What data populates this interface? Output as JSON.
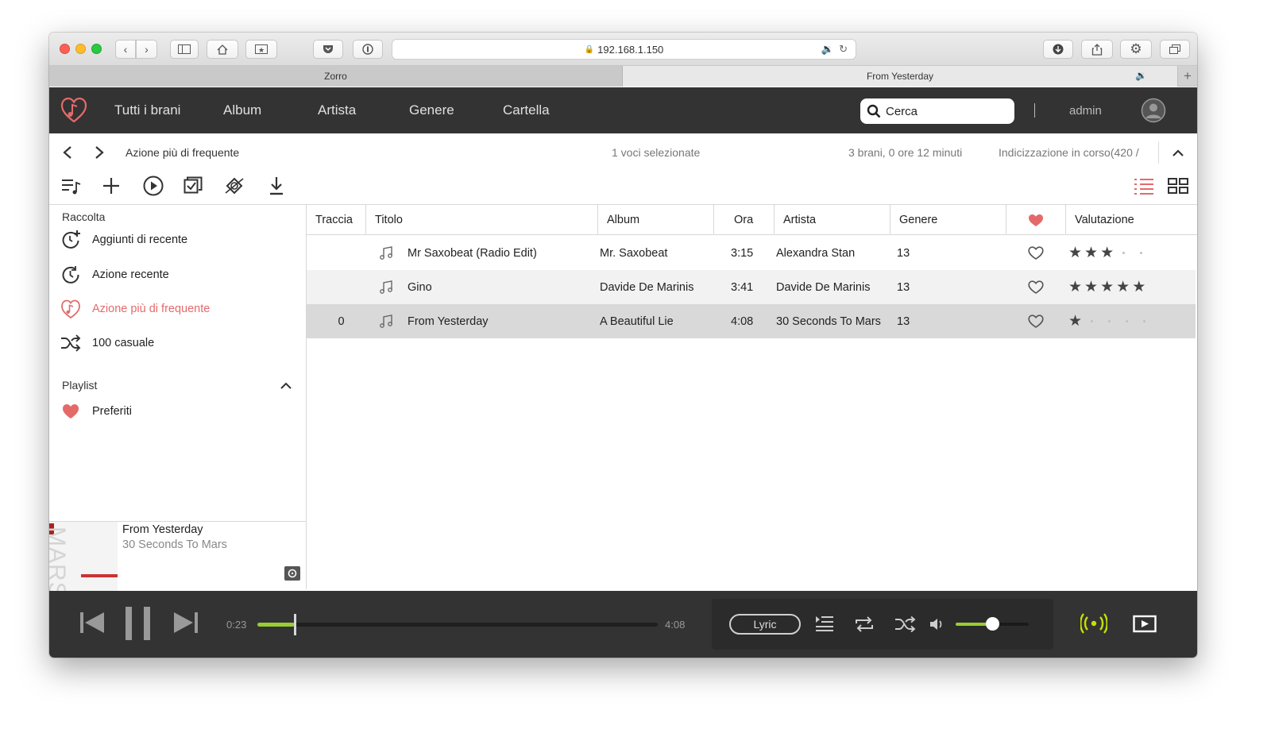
{
  "browser": {
    "url": "192.168.1.150",
    "tabs": [
      {
        "label": "Zorro"
      },
      {
        "label": "From Yesterday"
      }
    ]
  },
  "app": {
    "nav": [
      "Tutti i brani",
      "Album",
      "Artista",
      "Genere",
      "Cartella"
    ],
    "search_placeholder": "Cerca",
    "user": "admin"
  },
  "subbar": {
    "breadcrumb": "Azione più di frequente",
    "selected": "1 voci selezionate",
    "summary": "3 brani, 0 ore 12 minuti",
    "indexing": "Indicizzazione in corso(420 /"
  },
  "sidebar": {
    "collection_heading": "Raccolta",
    "items": [
      {
        "label": "Aggiunti di recente",
        "icon": "clock-plus-icon"
      },
      {
        "label": "Azione recente",
        "icon": "clock-icon"
      },
      {
        "label": "Azione più di frequente",
        "icon": "heart-note-icon",
        "active": true
      },
      {
        "label": "100 casuale",
        "icon": "shuffle-icon"
      }
    ],
    "playlist_heading": "Playlist",
    "playlists": [
      {
        "label": "Preferiti",
        "icon": "heart-icon"
      }
    ]
  },
  "now_playing": {
    "title": "From Yesterday",
    "artist": "30 Seconds To Mars",
    "cover_text": "MARS"
  },
  "table": {
    "columns": [
      "Traccia",
      "Titolo",
      "Album",
      "Ora",
      "Artista",
      "Genere",
      "",
      "Valutazione"
    ],
    "rows": [
      {
        "track": "",
        "title": "Mr Saxobeat (Radio Edit)",
        "album": "Mr. Saxobeat",
        "time": "3:15",
        "artist": "Alexandra Stan",
        "genre": "13",
        "rating": 3,
        "selected": false
      },
      {
        "track": "",
        "title": "Gino",
        "album": "Davide De Marinis",
        "time": "3:41",
        "artist": "Davide De Marinis",
        "genre": "13",
        "rating": 5,
        "selected": false
      },
      {
        "track": "0",
        "title": "From Yesterday",
        "album": "A Beautiful Lie",
        "time": "4:08",
        "artist": "30 Seconds To Mars",
        "genre": "13",
        "rating": 1,
        "selected": true
      }
    ]
  },
  "player": {
    "elapsed": "0:23",
    "duration": "4:08",
    "progress": 0.094,
    "lyric_label": "Lyric",
    "volume": 0.5
  },
  "colors": {
    "accent": "#e46a6a",
    "progress": "#9acd32",
    "header_bg": "#333333"
  }
}
